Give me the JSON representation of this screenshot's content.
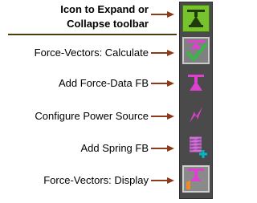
{
  "annotations": {
    "expand_line1": "Icon to Expand or",
    "expand_line2": "Collapse toolbar",
    "calculate": "Force-Vectors: Calculate",
    "add_force_data": "Add Force-Data FB",
    "configure_power": "Configure Power Source",
    "add_spring": "Add Spring FB",
    "display": "Force-Vectors: Display"
  },
  "toolbar": {
    "buttons": [
      {
        "name": "expand-collapse",
        "icon": "expand-collapse-icon"
      },
      {
        "name": "force-vectors-calculate",
        "icon": "force-vector-check-icon"
      },
      {
        "name": "add-force-data-fb",
        "icon": "force-data-icon"
      },
      {
        "name": "configure-power-source",
        "icon": "lightning-icon"
      },
      {
        "name": "add-spring-fb",
        "icon": "spring-icon"
      },
      {
        "name": "force-vectors-display",
        "icon": "force-vector-display-icon"
      }
    ]
  },
  "colors": {
    "arrow": "#8b3a1a",
    "toolbar_bg": "#4a4a4a",
    "expand_bg": "#78c22d",
    "icon_magenta": "#e040d0",
    "check_green": "#39b54a",
    "teal_plus": "#00b8c8",
    "orange": "#f08a24"
  }
}
